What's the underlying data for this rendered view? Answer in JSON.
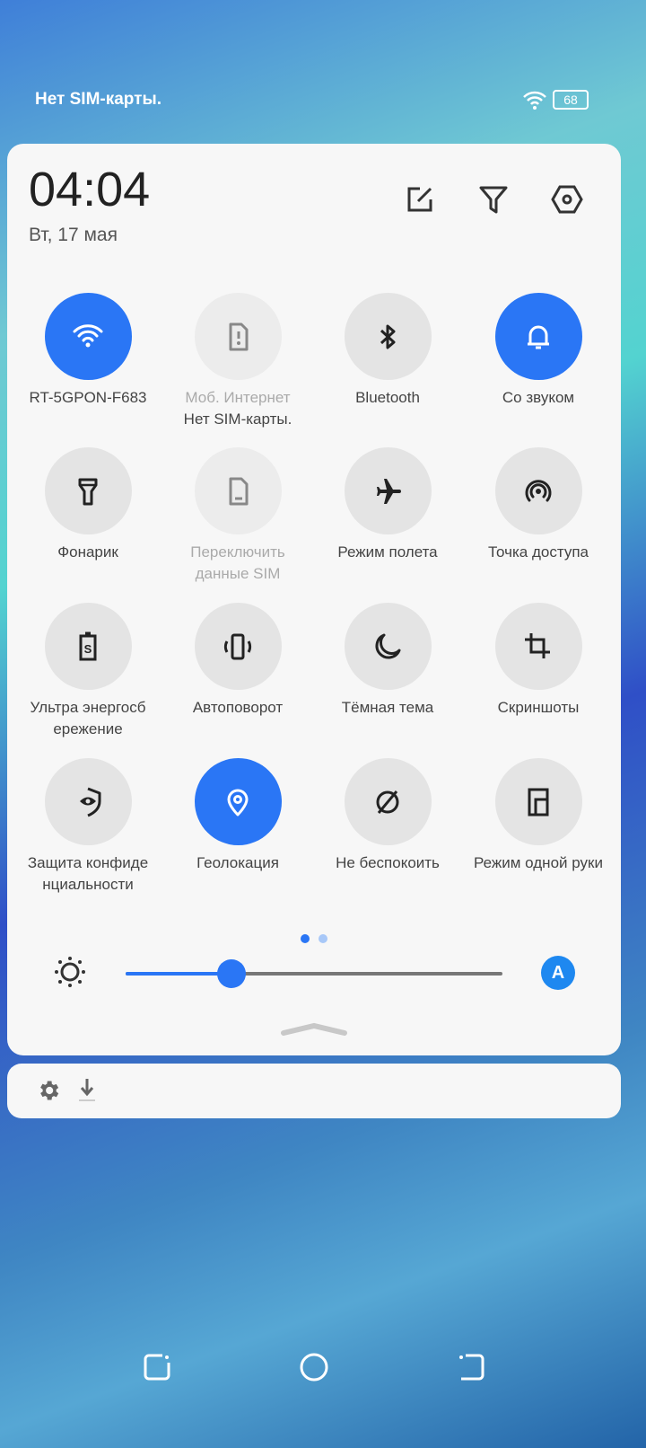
{
  "status_bar": {
    "carrier": "Нет SIM-карты.",
    "battery": "68",
    "icons": [
      "wifi-icon",
      "battery-icon"
    ]
  },
  "header": {
    "time": "04:04",
    "date": "Вт, 17 мая",
    "buttons": [
      "edit-icon",
      "filter-icon",
      "settings-icon"
    ]
  },
  "tiles": [
    {
      "label": "RT-5GPON-F683",
      "sub": "",
      "icon": "wifi-icon",
      "state": "on"
    },
    {
      "label": "Моб. Интернет",
      "sub": "Нет SIM-карты.",
      "icon": "sim-alert-icon",
      "state": "disabled"
    },
    {
      "label": "Bluetooth",
      "sub": "",
      "icon": "bluetooth-icon",
      "state": "off"
    },
    {
      "label": "Со звуком",
      "sub": "",
      "icon": "bell-icon",
      "state": "on"
    },
    {
      "label": "Фонарик",
      "sub": "",
      "icon": "flashlight-icon",
      "state": "off"
    },
    {
      "label": "Переключить данные SIM",
      "sub": "",
      "icon": "sim-icon",
      "state": "disabled"
    },
    {
      "label": "Режим полета",
      "sub": "",
      "icon": "airplane-icon",
      "state": "off"
    },
    {
      "label": "Точка доступа",
      "sub": "",
      "icon": "hotspot-icon",
      "state": "off"
    },
    {
      "label": "Ультра энергосб ережение",
      "sub": "",
      "icon": "battery-saver-icon",
      "state": "off"
    },
    {
      "label": "Автоповорот",
      "sub": "",
      "icon": "autorotate-icon",
      "state": "off"
    },
    {
      "label": "Тёмная тема",
      "sub": "",
      "icon": "moon-icon",
      "state": "off"
    },
    {
      "label": "Скриншоты",
      "sub": "",
      "icon": "crop-icon",
      "state": "off"
    },
    {
      "label": "Защита конфиде нциальности",
      "sub": "",
      "icon": "privacy-shield-icon",
      "state": "off"
    },
    {
      "label": "Геолокация",
      "sub": "",
      "icon": "location-icon",
      "state": "on"
    },
    {
      "label": "Не беспокоить",
      "sub": "",
      "icon": "do-not-disturb-icon",
      "state": "off"
    },
    {
      "label": "Режим одной руки",
      "sub": "",
      "icon": "one-hand-icon",
      "state": "off"
    }
  ],
  "pages": {
    "count": 2,
    "current": 1
  },
  "brightness": {
    "level": 0.28,
    "auto_label": "A"
  },
  "colors": {
    "accent": "#2a76f5",
    "tile_off": "#e4e4e4",
    "panel": "#f7f7f7"
  }
}
